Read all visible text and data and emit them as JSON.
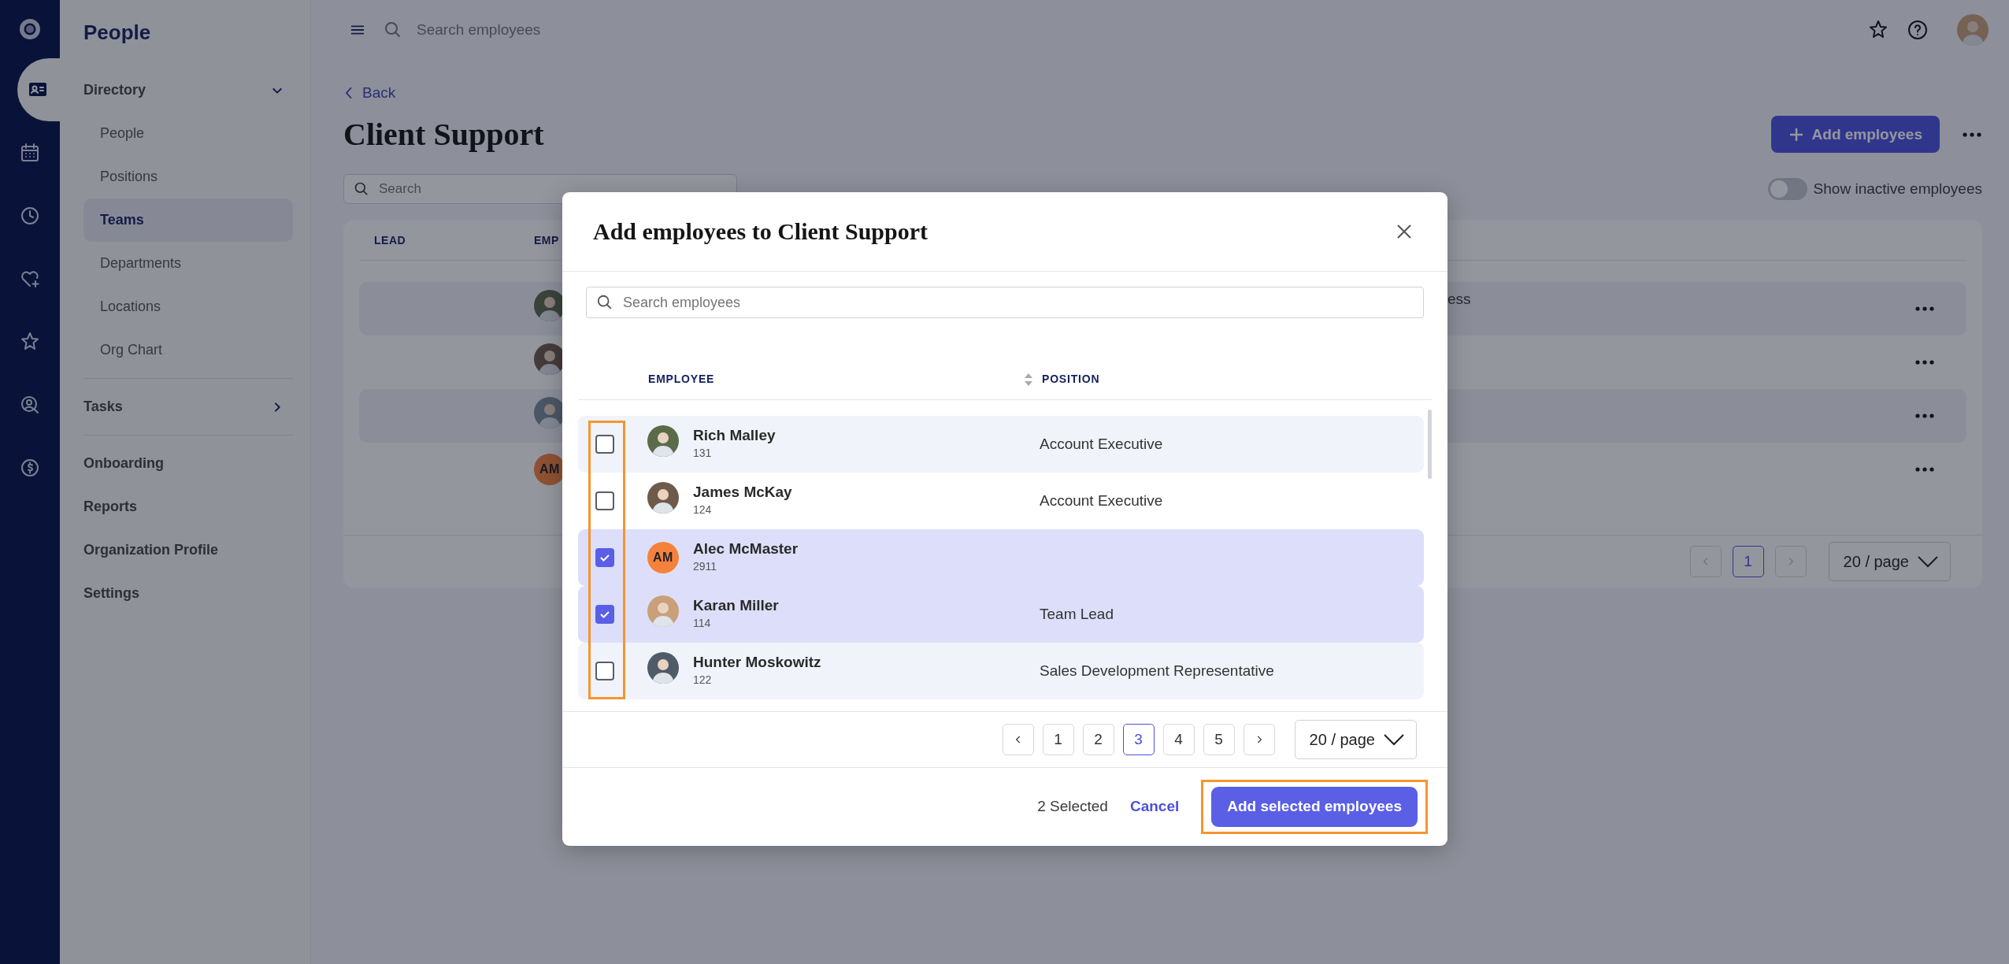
{
  "rail": {
    "items": [
      {
        "selected": true
      },
      {
        "selected": false
      },
      {
        "selected": false
      },
      {
        "selected": false
      },
      {
        "selected": false
      },
      {
        "selected": false
      },
      {
        "selected": false
      }
    ]
  },
  "sidebar": {
    "title": "People",
    "items": [
      {
        "kind": "group",
        "label": "Directory",
        "expanded": true,
        "children": [
          {
            "label": "People",
            "selected": false
          },
          {
            "label": "Positions",
            "selected": false
          },
          {
            "label": "Teams",
            "selected": true
          },
          {
            "label": "Departments",
            "selected": false
          },
          {
            "label": "Locations",
            "selected": false
          },
          {
            "label": "Org Chart",
            "selected": false
          }
        ]
      },
      {
        "kind": "group",
        "label": "Tasks",
        "expanded": false
      },
      {
        "kind": "link",
        "label": "Onboarding",
        "selected": false
      },
      {
        "kind": "link",
        "label": "Reports",
        "selected": false
      },
      {
        "kind": "link",
        "label": "Organization Profile",
        "selected": false
      },
      {
        "kind": "link",
        "label": "Settings",
        "selected": false
      }
    ]
  },
  "topbar": {
    "search": {
      "placeholder": "Search employees"
    }
  },
  "page": {
    "back": "Back",
    "title": "Client Support",
    "add_button": "Add employees",
    "search": {
      "placeholder": "Search"
    },
    "toggle": {
      "label": "Show inactive employees",
      "on": false
    },
    "table": {
      "columns": [
        "LEAD",
        "EMP"
      ],
      "rows": [
        {
          "avatar": {
            "kind": "photo"
          },
          "cell": "ess"
        },
        {
          "avatar": {
            "kind": "photo"
          }
        },
        {
          "avatar": {
            "kind": "photo"
          }
        },
        {
          "avatar": {
            "kind": "initials",
            "text": "AM"
          }
        }
      ]
    },
    "pagination": {
      "pages": [
        {
          "label": "1",
          "selected": true
        }
      ],
      "page_size": "20 / page"
    }
  },
  "modal": {
    "title": "Add employees to Client Support",
    "search": {
      "placeholder": "Search employees"
    },
    "columns": [
      "EMPLOYEE",
      "POSITION"
    ],
    "rows": [
      {
        "name": "Rich Malley",
        "number": "131",
        "position": "Account Executive",
        "checked": false,
        "avatar": {
          "kind": "photo"
        }
      },
      {
        "name": "James McKay",
        "number": "124",
        "position": "Account Executive",
        "checked": false,
        "avatar": {
          "kind": "photo"
        }
      },
      {
        "name": "Alec McMaster",
        "number": "2911",
        "checked": true,
        "avatar": {
          "kind": "initials",
          "text": "AM"
        }
      },
      {
        "name": "Karan Miller",
        "number": "114",
        "position": "Team Lead",
        "checked": true,
        "avatar": {
          "kind": "photo"
        }
      },
      {
        "name": "Hunter Moskowitz",
        "number": "122",
        "position": "Sales Development Representative",
        "checked": false,
        "avatar": {
          "kind": "photo"
        }
      }
    ],
    "pages": [
      {
        "label": "1",
        "selected": false
      },
      {
        "label": "2",
        "selected": false
      },
      {
        "label": "3",
        "selected": true
      },
      {
        "label": "4",
        "selected": false
      },
      {
        "label": "5",
        "selected": false
      }
    ],
    "page_size": "20 / page",
    "selected_count": "2 Selected",
    "cancel": "Cancel",
    "submit": "Add selected employees",
    "highlights": {
      "checkboxes": true,
      "submit": true
    }
  }
}
